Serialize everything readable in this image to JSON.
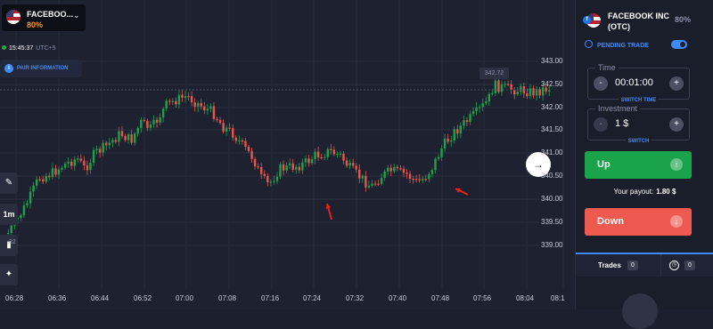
{
  "asset_badge": {
    "name": "FACEBOO...",
    "payout_pct": "80%",
    "chevron_icon": "chevron-down-icon"
  },
  "clock": {
    "time": "15:45:37",
    "tz": "UTC+5"
  },
  "pair_info_label": "PAIR INFORMATION",
  "tools": {
    "draw_icon": "pencil-icon",
    "timeframe": "1m",
    "indicators_icon": "indicators-icon",
    "settings_icon": "satellite-icon"
  },
  "price_last": "342.72",
  "price_low_partial": ".32",
  "y_axis_labels": [
    "343.00",
    "342.50",
    "342.00",
    "341.50",
    "341.00",
    "340.50",
    "340.00",
    "339.50",
    "339.00"
  ],
  "x_axis_labels": [
    "06:28",
    "06:36",
    "06:44",
    "06:52",
    "07:00",
    "07:08",
    "07:16",
    "07:24",
    "07:32",
    "07:40",
    "07:48",
    "07:56",
    "08:04",
    "08:1"
  ],
  "colors": {
    "bull": "#1aa34a",
    "bear": "#e8574c",
    "accent": "#3d8bfd",
    "up_button": "#1aa34a",
    "down_button": "#ee5a4f"
  },
  "panel": {
    "asset_name": "FACEBOOK INC (OTC)",
    "payout_pct": "80%",
    "pending_trade_label": "PENDING TRADE",
    "time": {
      "label": "Time",
      "value": "00:01:00",
      "sub": "SWITCH TIME",
      "minus": "-",
      "plus": "+"
    },
    "investment": {
      "label": "Investment",
      "value": "1 $",
      "sub": "SWITCH",
      "minus": "-",
      "plus": "+"
    },
    "up_label": "Up",
    "down_label": "Down",
    "payout_label": "Your payout:",
    "payout_value": "1.80 $",
    "trades_label": "Trades",
    "trades_count": "0",
    "pending_count": "0"
  }
}
